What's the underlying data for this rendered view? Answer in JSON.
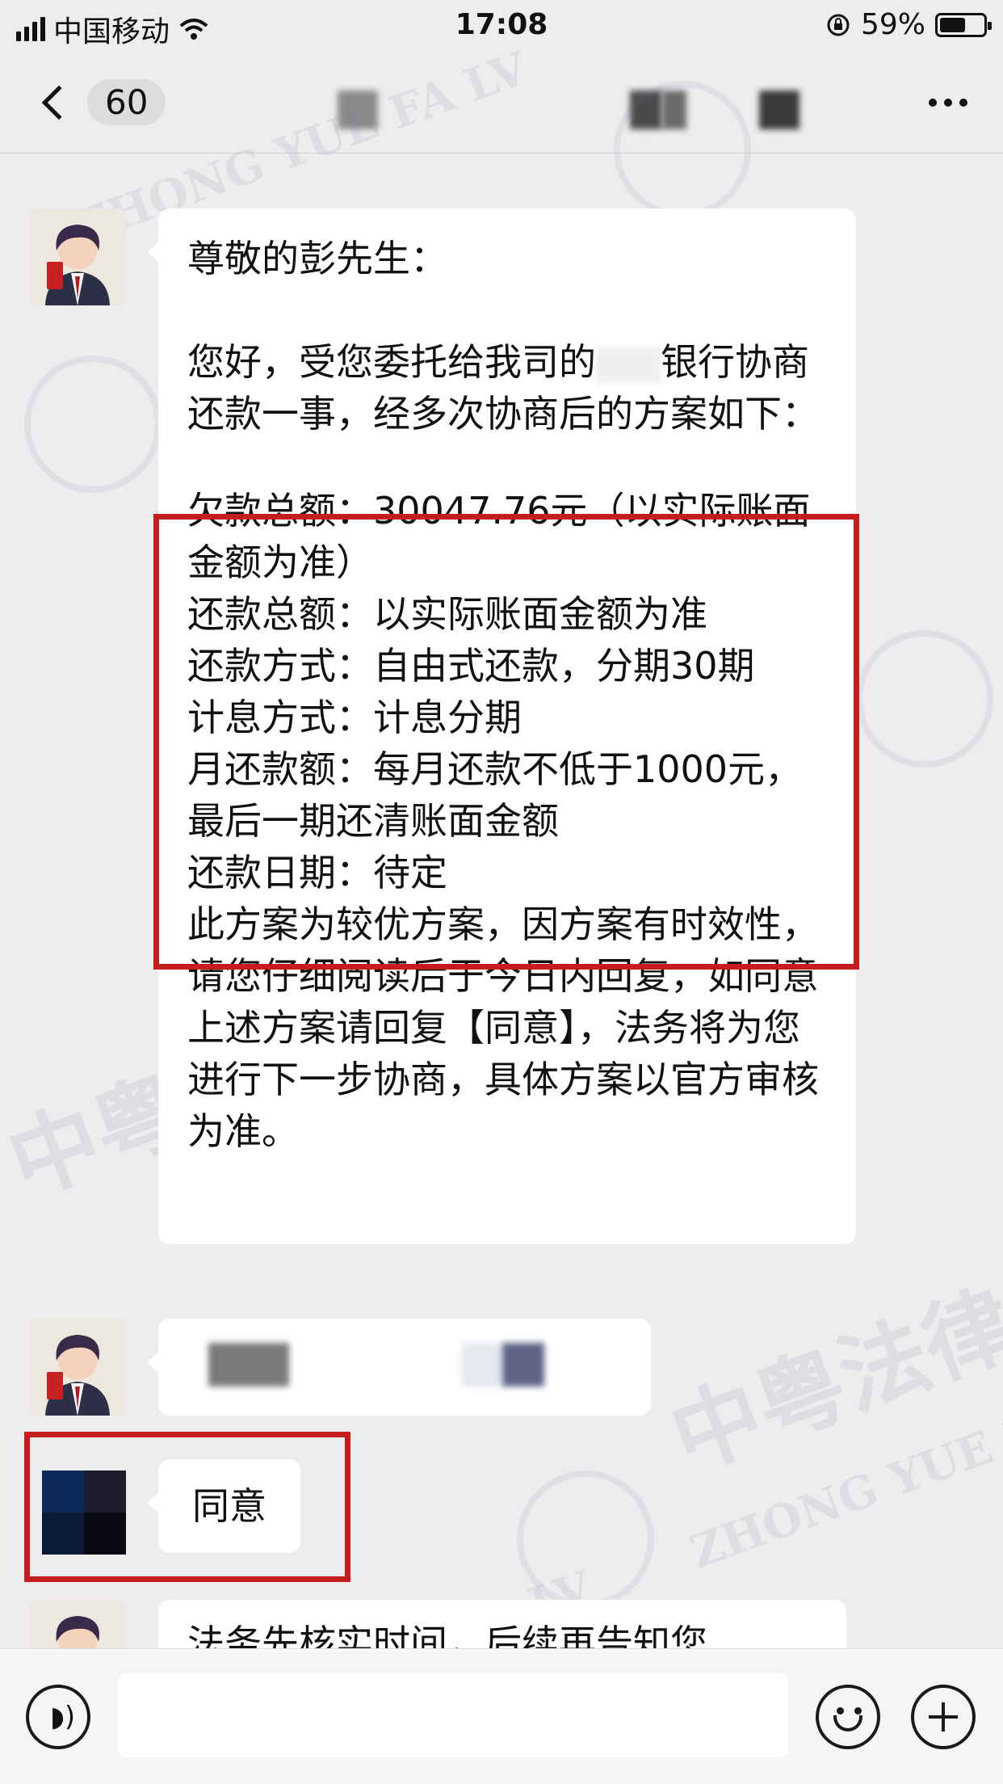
{
  "status_bar": {
    "carrier": "中国移动",
    "time": "17:08",
    "battery": "59%"
  },
  "nav": {
    "back_count": "60",
    "more_icon": "more-dots-icon"
  },
  "watermark": {
    "cn": "中粤法律",
    "en": "ZHONG YUE FA LV",
    "seal": "中"
  },
  "messages": [
    {
      "sender": "lawyer",
      "greeting": "尊敬的彭先生：",
      "intro": "您好，受您委托给我司的",
      "intro_bank": "银行",
      "intro_rest": "协商还款一事，经多次协商后的方案如下：",
      "scheme": [
        "欠款总额：30047.76元（以实际账面金额为准）",
        "还款总额：以实际账面金额为准",
        "还款方式：自由式还款，分期30期",
        "计息方式：计息分期",
        "月还款额：每月还款不低于1000元，最后一期还清账面金额",
        "还款日期：待定"
      ],
      "closing": "此方案为较优方案，因方案有时效性，请您仔细阅读后于今日内回复，如同意上述方案请回复【同意】，法务将为您进行下一步协商，具体方案以官方审核为准。"
    },
    {
      "sender": "lawyer",
      "text": ""
    },
    {
      "sender": "client",
      "text": "同意"
    },
    {
      "sender": "lawyer",
      "text": "法务先核实时间，后续再告知您"
    }
  ],
  "input_bar": {
    "voice_icon": "voice-icon",
    "emoji_icon": "emoji-icon",
    "plus_icon": "plus-icon"
  }
}
